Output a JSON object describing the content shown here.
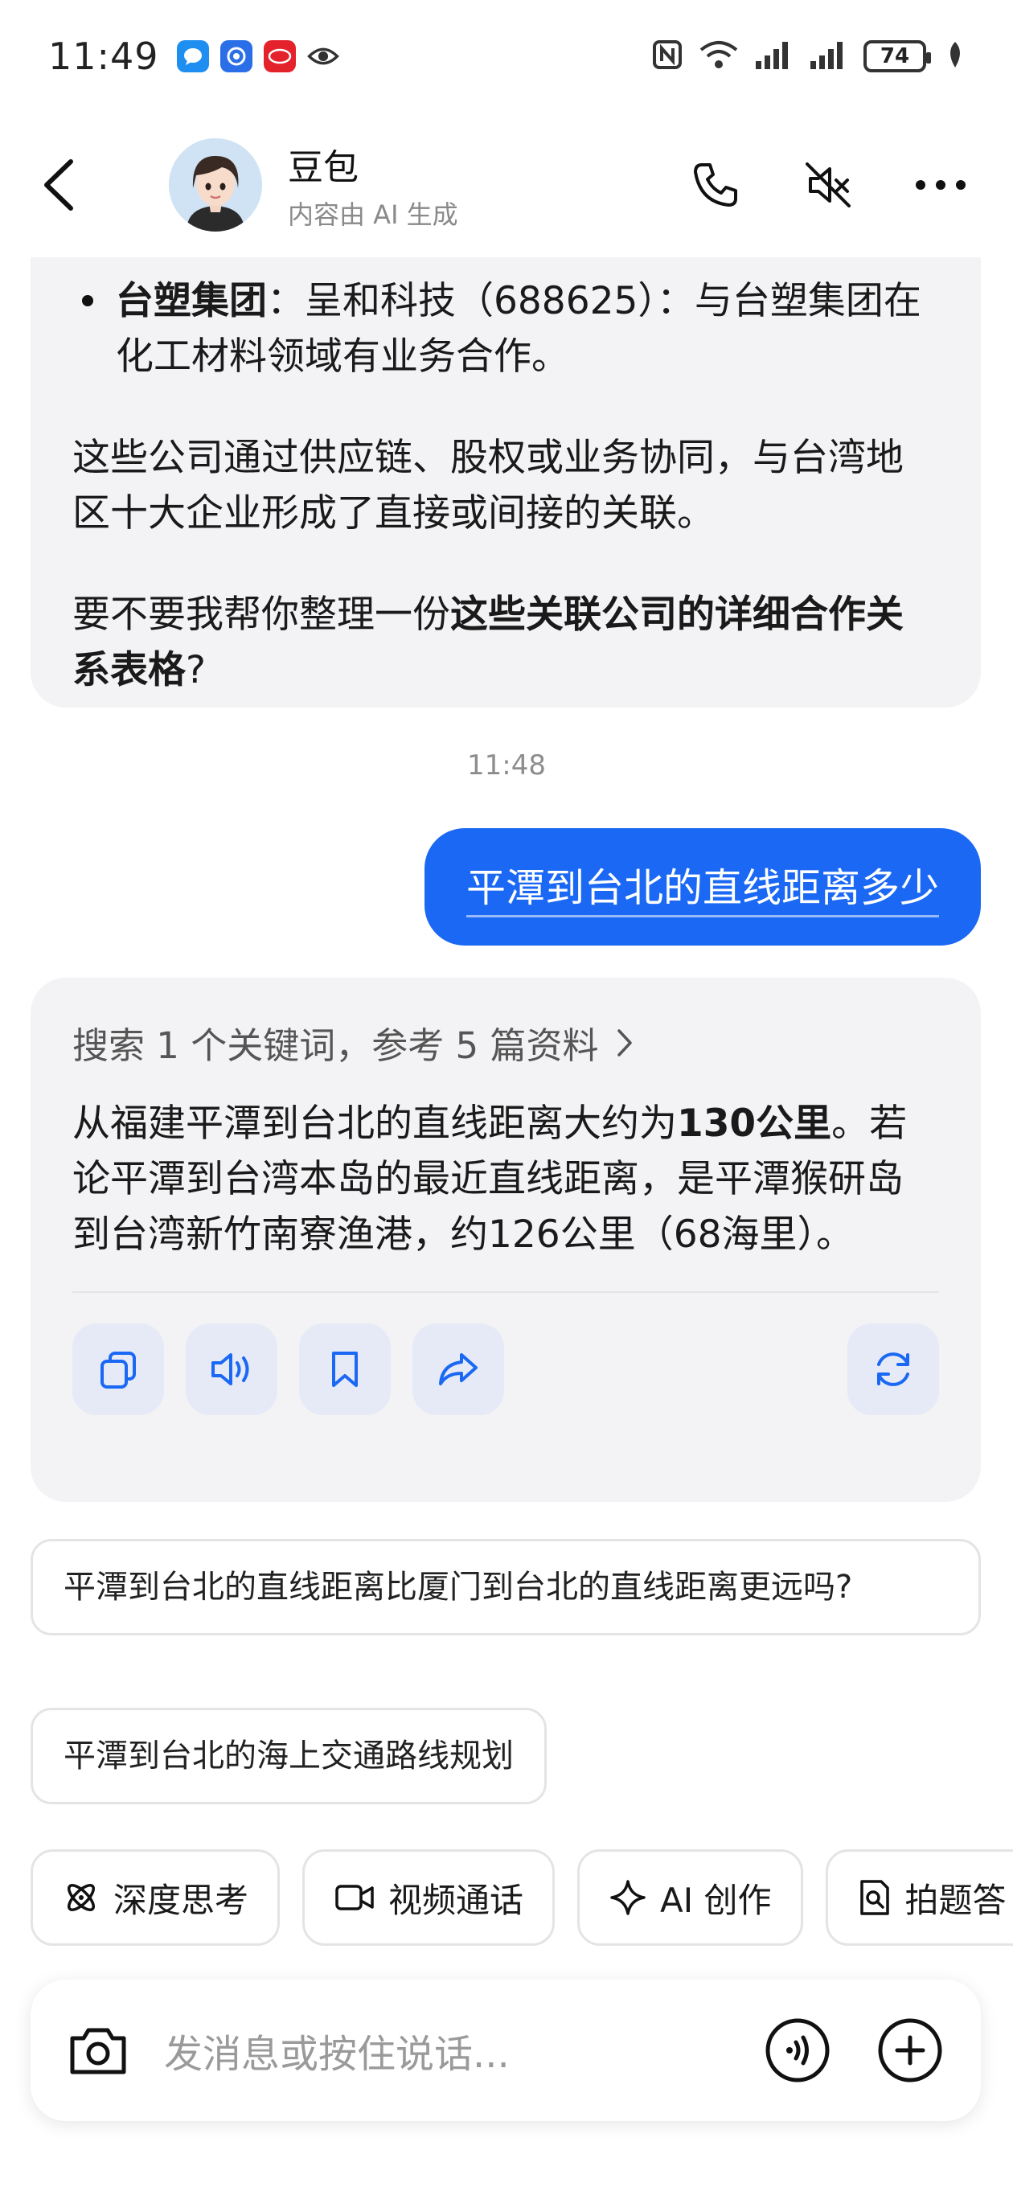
{
  "status_bar": {
    "time": "11:49",
    "battery": "74"
  },
  "header": {
    "name": "豆包",
    "subtitle": "内容由 AI 生成"
  },
  "previous_message": {
    "bullet_bold": "台塑集团",
    "bullet_text": "：呈和科技（688625）：与台塑集团在化工材料领域有业务合作。",
    "paragraph1": "这些公司通过供应链、股权或业务协同，与台湾地区十大企业形成了直接或间接的关联。",
    "paragraph2_pre": "要不要我帮你整理一份",
    "paragraph2_bold": "这些关联公司的详细合作关系表格",
    "paragraph2_post": "?"
  },
  "timestamp": "11:48",
  "user_message": "平潭到台北的直线距离多少",
  "answer": {
    "search_summary": "搜索 1 个关键词，参考 5 篇资料",
    "text_pre": "从福建平潭到台北的直线距离大约为",
    "text_bold": "130公里",
    "text_post": "。若论平潭到台湾本岛的最近直线距离，是平潭猴研岛到台湾新竹南寮渔港，约126公里（68海里）。"
  },
  "suggestions": [
    "平潭到台北的直线距离比厦门到台北的直线距离更远吗?",
    "平潭到台北的海上交通路线规划"
  ],
  "tools": [
    {
      "label": "深度思考",
      "icon": "atom-icon"
    },
    {
      "label": "视频通话",
      "icon": "video-icon"
    },
    {
      "label": "AI 创作",
      "icon": "sparkle-icon"
    },
    {
      "label": "拍题答",
      "icon": "scan-doc-icon"
    }
  ],
  "input": {
    "placeholder": "发消息或按住说话..."
  },
  "colors": {
    "accent": "#1a68f4",
    "bubble_bg": "#f3f3f5",
    "action_bg": "#e6eaf6"
  }
}
